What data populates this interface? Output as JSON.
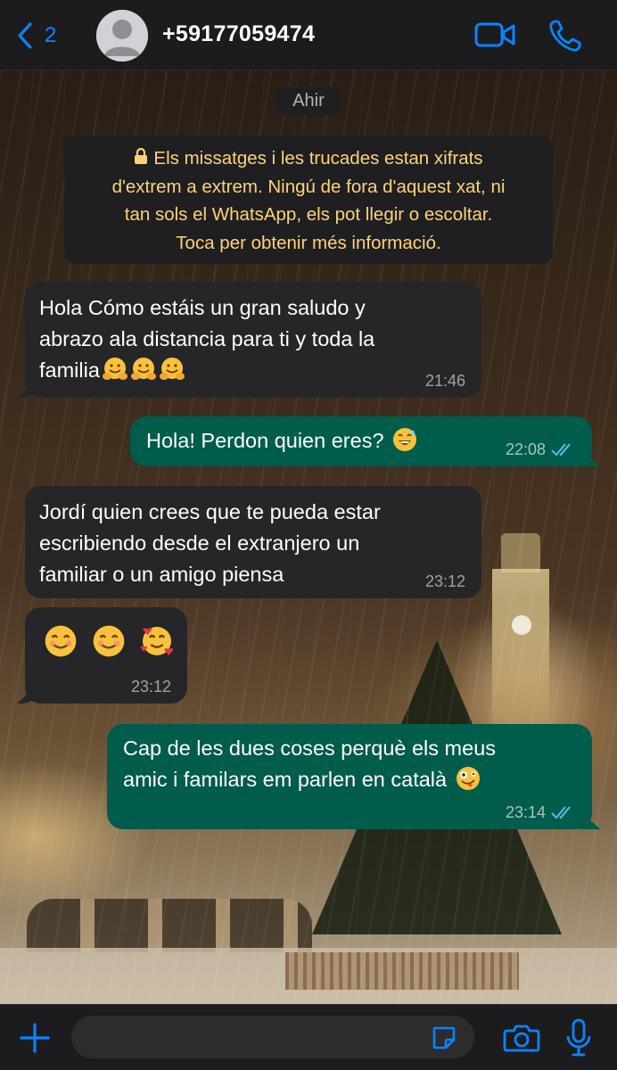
{
  "header": {
    "back_count": "2",
    "contact_name": "+59177059474",
    "accent_color": "#0a84ff",
    "icons": [
      "chevron-left-icon",
      "avatar-placeholder-icon",
      "video-call-icon",
      "phone-call-icon"
    ]
  },
  "chat": {
    "date_label": "Ahir",
    "encryption_notice": {
      "lines": [
        "Els missatges i les trucades estan xifrats",
        "d'extrem a extrem. Ningú de fora d'aquest xat, ni",
        "tan sols el WhatsApp, els pot llegir o escoltar.",
        "Toca per obtenir més informació."
      ],
      "color": "#ffd279"
    },
    "messages": [
      {
        "direction": "incoming",
        "lines": [
          "Hola Cómo estáis un gran saludo y",
          "abrazo ala distancia para ti y toda la",
          "familia"
        ],
        "emojis": [
          "hugging-face",
          "hugging-face",
          "hugging-face"
        ],
        "time": "21:46"
      },
      {
        "direction": "outgoing",
        "text": "Hola! Perdon quien eres?",
        "emojis": [
          "grinning-sweat-face"
        ],
        "time": "22:08",
        "status": "read"
      },
      {
        "direction": "incoming",
        "lines": [
          "Jordí quien crees que te pueda estar",
          "escribiendo desde el extranjero un",
          "familiar o un amigo piensa"
        ],
        "time": "23:12"
      },
      {
        "direction": "incoming",
        "emojis": [
          "smiling-face",
          "smiling-face",
          "smiling-face-with-hearts"
        ],
        "time": "23:12"
      },
      {
        "direction": "outgoing",
        "lines": [
          "Cap de les dues coses perquè els meus",
          "amic i familars em parlen en català"
        ],
        "emojis": [
          "zany-face"
        ],
        "time": "23:14",
        "status": "read"
      }
    ],
    "incoming_bubble_color": "#262628",
    "outgoing_bubble_color": "#005c4b",
    "read_tick_color": "#53bdeb"
  },
  "input_bar": {
    "message_value": "",
    "icons": [
      "plus-icon",
      "sticker-icon",
      "camera-icon",
      "microphone-icon"
    ]
  }
}
